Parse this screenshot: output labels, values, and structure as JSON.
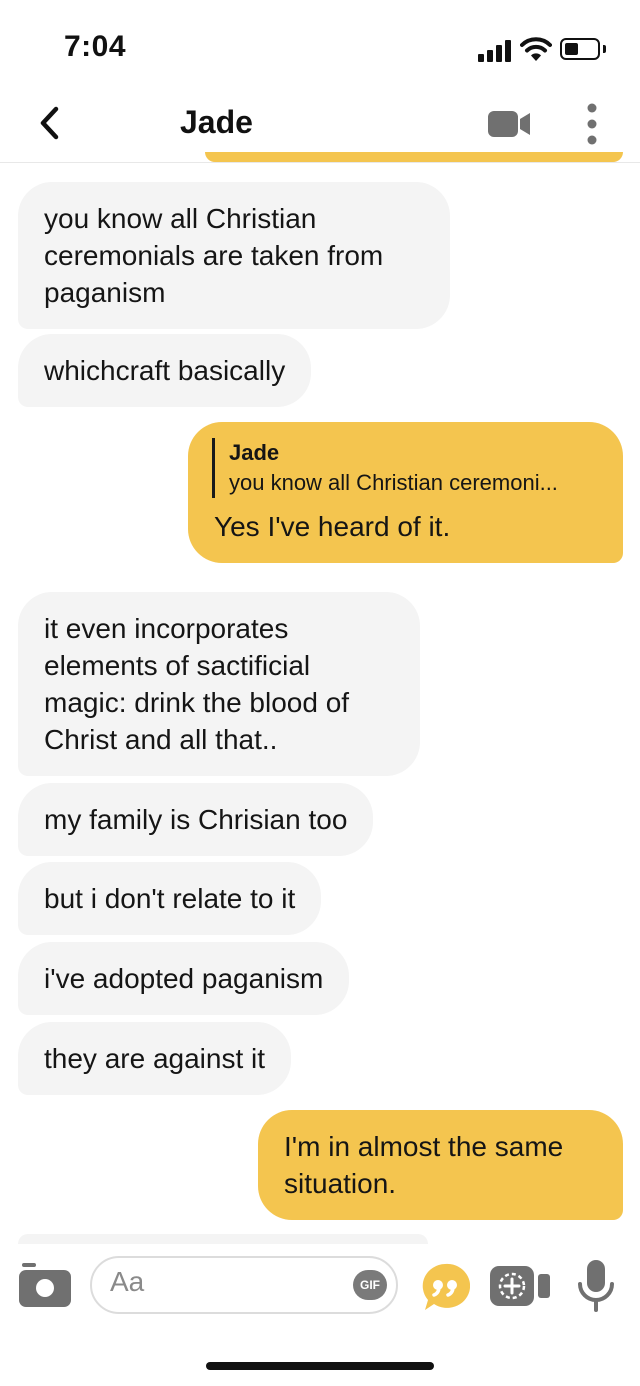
{
  "status_bar": {
    "time": "7:04"
  },
  "header": {
    "title": "Jade"
  },
  "messages": [
    {
      "direction": "incoming",
      "text": "you know all Christian ceremonials are taken from paganism"
    },
    {
      "direction": "incoming",
      "text": "whichcraft basically"
    },
    {
      "direction": "outgoing",
      "reply_to": {
        "name": "Jade",
        "snippet": "you know all Christian ceremoni..."
      },
      "text": "Yes I've heard of it."
    },
    {
      "direction": "incoming",
      "text": "it even incorporates elements of sactificial magic: drink the blood of Christ and all that.."
    },
    {
      "direction": "incoming",
      "text": "my family is Chrisian too"
    },
    {
      "direction": "incoming",
      "text": "but i don't relate to it"
    },
    {
      "direction": "incoming",
      "text": "i've adopted paganism"
    },
    {
      "direction": "incoming",
      "text": "they are against it"
    },
    {
      "direction": "outgoing",
      "text": "I'm in almost the same situation."
    }
  ],
  "composer": {
    "placeholder": "Aa",
    "gif_label": "GIF"
  },
  "icons": {
    "back": "chevron-left-icon",
    "video": "video-camera-icon",
    "more": "vertical-dots-icon",
    "camera": "camera-icon",
    "quote": "quote-bubble-icon",
    "media": "video-add-icon",
    "mic": "microphone-icon"
  },
  "colors": {
    "accent": "#f4c54f",
    "incoming_bubble": "#f4f4f4",
    "icon_gray": "#707070"
  }
}
